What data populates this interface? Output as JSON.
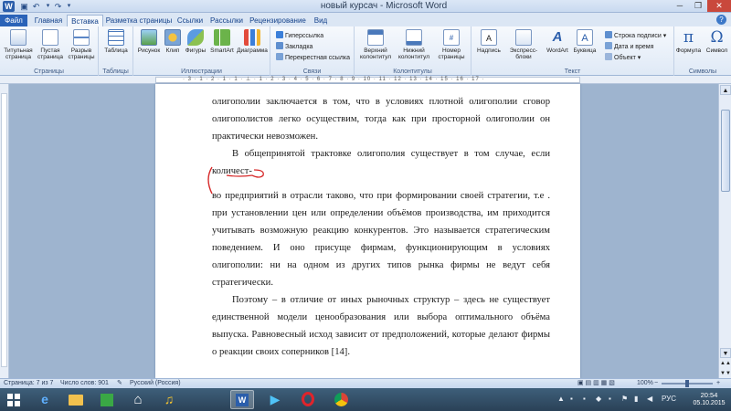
{
  "window": {
    "title": "новый курсач - Microsoft Word",
    "logo": "W",
    "close_glyph": "✕",
    "min_glyph": "─",
    "max_glyph": "❐"
  },
  "quick_access": {
    "save_icon": "save-icon",
    "undo_icon": "undo-icon",
    "redo_icon": "redo-icon",
    "customize_icon": "chevron-down-icon"
  },
  "tabs": [
    "Файл",
    "Главная",
    "Вставка",
    "Разметка страницы",
    "Ссылки",
    "Рассылки",
    "Рецензирование",
    "Вид"
  ],
  "active_tab": "Вставка",
  "ribbon": {
    "groups": {
      "pages": {
        "label": "Страницы",
        "buttons": [
          "Титульная страница",
          "Пустая страница",
          "Разрыв страницы"
        ]
      },
      "tables": {
        "label": "Таблицы",
        "buttons": [
          "Таблица"
        ]
      },
      "illustrations": {
        "label": "Иллюстрации",
        "buttons": [
          "Рисунок",
          "Клип",
          "Фигуры",
          "SmartArt",
          "Диаграмма"
        ]
      },
      "links": {
        "label": "Связи",
        "items": [
          "Гиперссылка",
          "Закладка",
          "Перекрестная ссылка"
        ]
      },
      "header_footer": {
        "label": "Колонтитулы",
        "buttons": [
          "Верхний колонтитул",
          "Нижний колонтитул",
          "Номер страницы"
        ]
      },
      "text": {
        "label": "Текст",
        "buttons": [
          "Надпись",
          "Экспресс-блоки",
          "WordArt",
          "Буквица"
        ],
        "items": [
          "Строка подписи",
          "Дата и время",
          "Объект"
        ]
      },
      "symbols": {
        "label": "Символы",
        "buttons": [
          "Формула",
          "Символ"
        ]
      }
    }
  },
  "ruler": {
    "numbers": "· 3 · 1 · 2 · 1 · 1 · ⊥ · 1 · 2 · 3 · 4 · 5 · 6 · 7 · 8 · 9 · 10 · 11 · 12 · 13 · 14 · 15 · 16 · 17 ·"
  },
  "document": {
    "paragraphs": [
      {
        "text": "олигополии заключается в том, что в условиях плотной олигополии сговор олигополистов легко осуществим, тогда как при просторной олигополии он практически невозможен.",
        "indent": false
      },
      {
        "text": "В общепринятой трактовке олигополия существует в том случае, если количест-",
        "indent": true
      },
      {
        "text": "во предприятий в отрасли таково, что при формировании своей стратегии, т.е . при установлении цен или определении объёмов производства, им приходится учитывать возможную реакцию конкурентов. Это называется стратегическим поведением. И оно присуще фирмам, функционирующим в условиях олигополии: ни на одном из других типов рынка фирмы не ведут себя стратегически.",
        "indent": false
      },
      {
        "text": "Поэтому – в отличие от иных рыночных структур – здесь не существует единственной модели ценообразования или выбора оптимального объёма выпуска. Равновесный исход зависит от предположений, которые делают фирмы о реакции своих соперников [14].",
        "indent": true
      }
    ],
    "annotation_color": "#d62828"
  },
  "status": {
    "page": "Страница: 7 из 7",
    "words": "Число слов: 901",
    "language": "Русский (Россия)",
    "zoom": "100%",
    "zoom_level": 1.0
  },
  "taskbar": {
    "apps": [
      "start-icon",
      "internet-explorer-icon",
      "file-explorer-icon",
      "store-icon",
      "home-icon",
      "headphones-icon",
      "word-icon",
      "media-player-icon",
      "opera-icon",
      "chrome-icon"
    ],
    "active_app": "word-icon",
    "language": "РУС",
    "time": "20:54",
    "date": "05.10.2015"
  }
}
